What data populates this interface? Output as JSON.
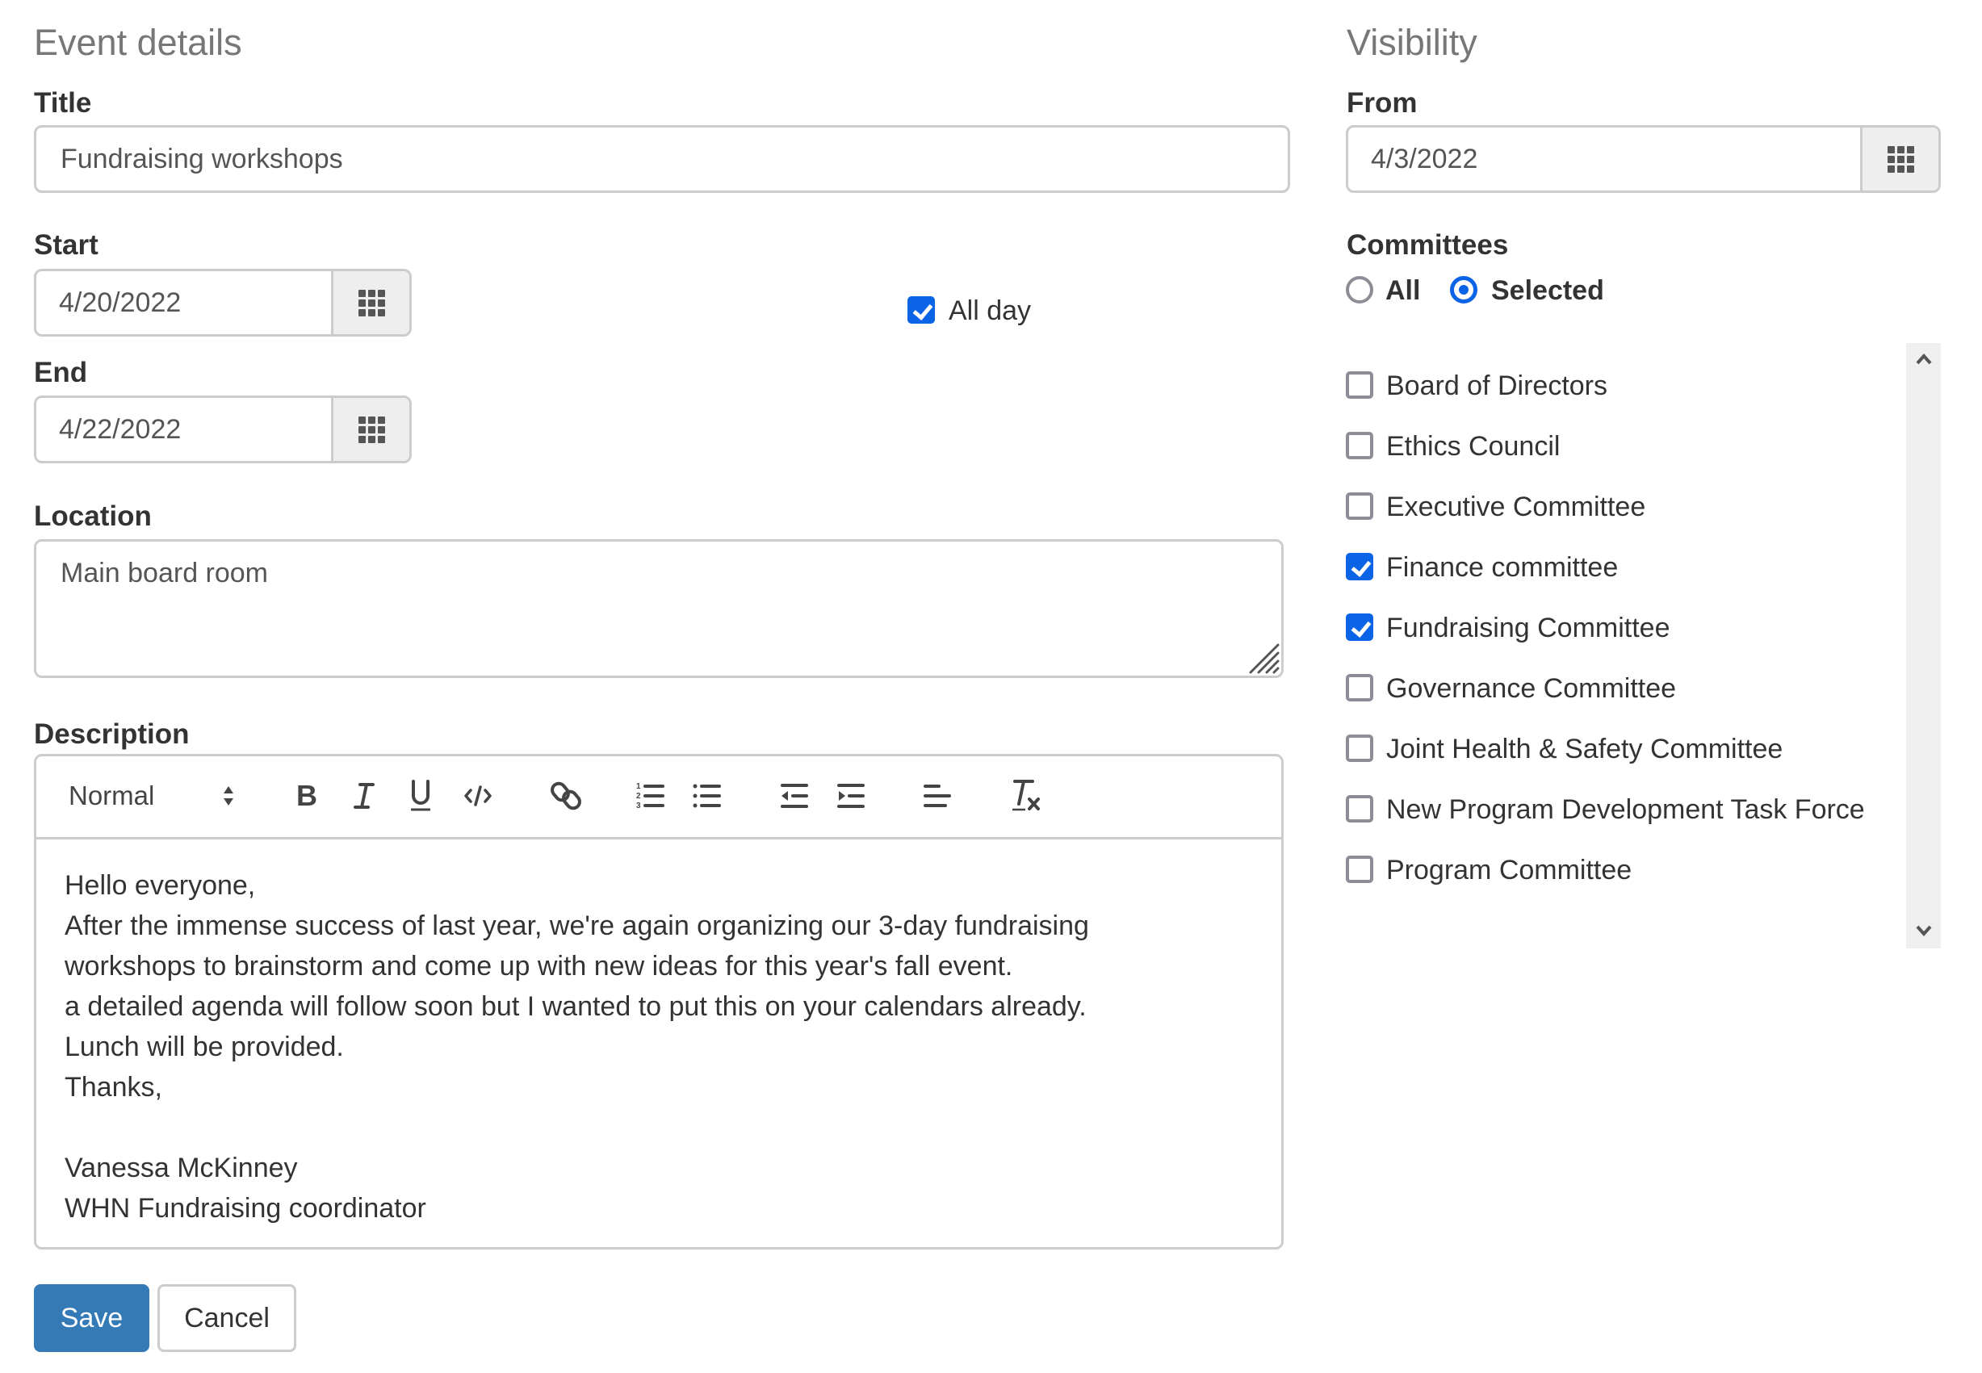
{
  "event_details": {
    "heading": "Event details",
    "title": {
      "label": "Title",
      "value": "Fundraising workshops"
    },
    "start": {
      "label": "Start",
      "value": "4/20/2022",
      "picker_icon": "calendar-grid-icon"
    },
    "all_day": {
      "label": "All day",
      "checked": true
    },
    "end": {
      "label": "End",
      "value": "4/22/2022",
      "picker_icon": "calendar-grid-icon"
    },
    "location": {
      "label": "Location",
      "value": "Main board room"
    },
    "description": {
      "label": "Description",
      "toolbar": {
        "format_select": "Normal",
        "buttons": [
          "bold",
          "italic",
          "underline",
          "code",
          "link",
          "ordered-list",
          "bullet-list",
          "outdent",
          "indent",
          "align",
          "clear-formatting"
        ]
      },
      "lines": [
        "Hello everyone,",
        "After the immense success of last year, we're again organizing our 3-day fundraising",
        "workshops to brainstorm and come up with new ideas for this year's fall event.",
        "a detailed agenda will follow soon but I wanted to put this on your calendars already.",
        "Lunch will be provided.",
        "Thanks,",
        "",
        "Vanessa McKinney",
        "WHN Fundraising coordinator"
      ]
    }
  },
  "actions": {
    "save": "Save",
    "cancel": "Cancel"
  },
  "visibility": {
    "heading": "Visibility",
    "from": {
      "label": "From",
      "value": "4/3/2022",
      "picker_icon": "calendar-grid-icon"
    },
    "committees": {
      "label": "Committees",
      "options": [
        {
          "label": "All",
          "selected": false
        },
        {
          "label": "Selected",
          "selected": true
        }
      ],
      "items": [
        {
          "label": "Board of Directors",
          "checked": false
        },
        {
          "label": "Ethics Council",
          "checked": false
        },
        {
          "label": "Executive Committee",
          "checked": false
        },
        {
          "label": "Finance committee",
          "checked": true
        },
        {
          "label": "Fundraising Committee",
          "checked": true
        },
        {
          "label": "Governance Committee",
          "checked": false
        },
        {
          "label": "Joint Health & Safety Committee",
          "checked": false
        },
        {
          "label": "New Program Development Task Force",
          "checked": false
        },
        {
          "label": "Program Committee",
          "checked": false
        }
      ]
    }
  },
  "colors": {
    "accent": "#0b63e5",
    "primary_button": "#337ab7",
    "heading_gray": "#777777"
  }
}
